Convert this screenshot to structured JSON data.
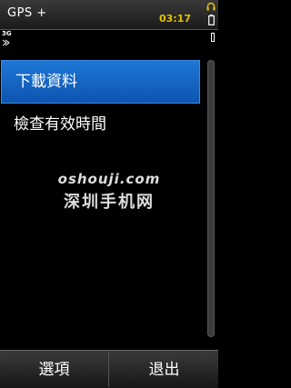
{
  "statusbar": {
    "app_title": "GPS +",
    "time": "03:17",
    "network": "3G",
    "headset_icon": "headset-icon",
    "battery_icon": "battery-icon",
    "signal_icon": "signal-icon"
  },
  "list": {
    "items": [
      {
        "label": "下載資料",
        "selected": true
      },
      {
        "label": "檢查有效時間",
        "selected": false
      }
    ]
  },
  "watermark": {
    "url": "oshouji.com",
    "name": "深圳手机网"
  },
  "softkeys": {
    "left": "選項",
    "right": "退出"
  },
  "colors": {
    "selection": "#1565c0",
    "clock": "#e6c300",
    "background": "#000000"
  }
}
